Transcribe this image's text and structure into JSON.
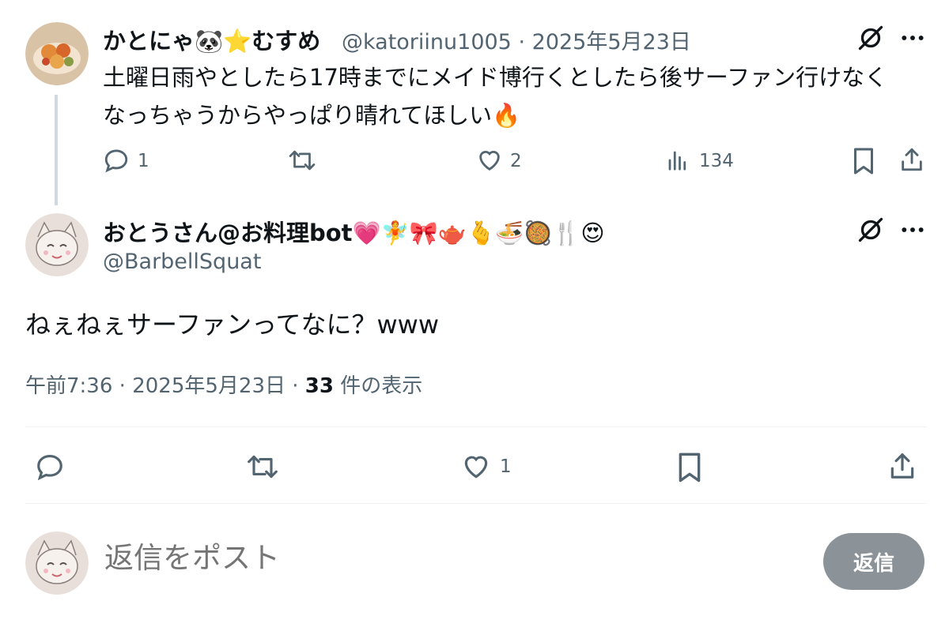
{
  "parent_tweet": {
    "author_name": "かとにゃ🐼⭐むすめ",
    "author_handle": "@katoriinu1005",
    "separator": "·",
    "date": "2025年5月23日",
    "text_line1": "土曜日雨やとしたら17時までにメイド博行くとしたら後サーファン行けなく",
    "text_line2": "なっちゃうからやっぱり晴れてほしい🔥",
    "reply_count": "1",
    "like_count": "2",
    "view_count": "134"
  },
  "main_tweet": {
    "author_name": "おとうさん@お料理bot💗🧚🎀🫖🫰🍜🥘🍴😍",
    "author_handle": "@BarbellSquat",
    "text": "ねぇねぇサーファンってなに？www",
    "time": "午前7:36",
    "separator": "·",
    "date": "2025年5月23日",
    "view_count": "33",
    "view_suffix": "件の表示",
    "like_count": "1"
  },
  "reply_box": {
    "placeholder": "返信をポスト",
    "button_label": "返信"
  },
  "icons": {
    "reply": "comment-icon",
    "retweet": "retweet-icon",
    "like": "heart-icon",
    "views": "bar-chart-icon",
    "bookmark": "bookmark-icon",
    "share": "share-icon",
    "more": "more-icon",
    "grok": "grok-icon"
  },
  "colors": {
    "text": "#0f1419",
    "secondary": "#536471",
    "button_disabled": "#8c9398",
    "divider": "#eff3f4"
  }
}
